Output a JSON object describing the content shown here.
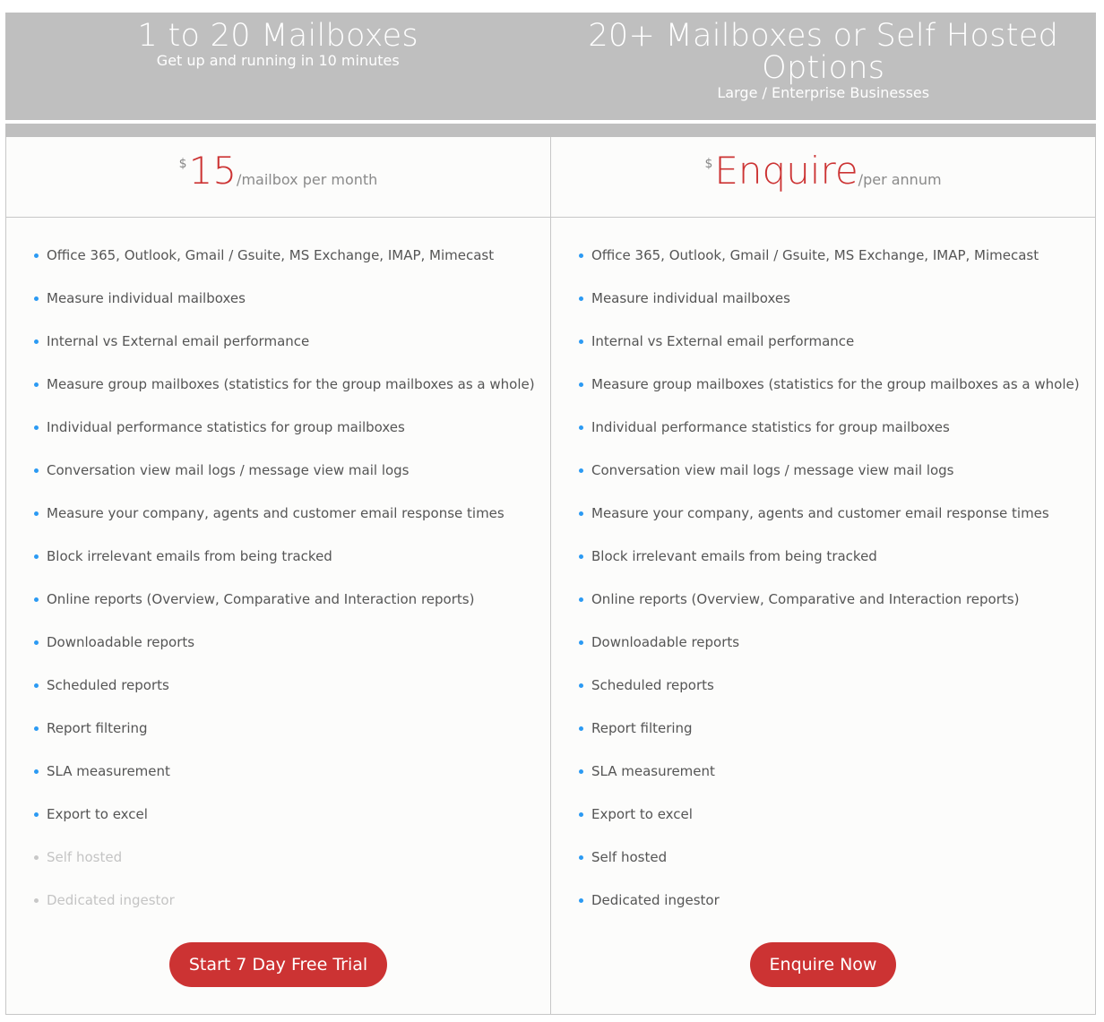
{
  "plans": [
    {
      "title": "1 to 20 Mailboxes",
      "subtitle": "Get up and running in 10 minutes",
      "currency": "$",
      "amount": "15",
      "period": "/mailbox per month",
      "cta": "Start 7 Day Free Trial",
      "features": [
        {
          "label": "Office 365, Outlook, Gmail / Gsuite, MS Exchange, IMAP, Mimecast",
          "included": true
        },
        {
          "label": "Measure individual mailboxes",
          "included": true
        },
        {
          "label": "Internal vs External email performance",
          "included": true
        },
        {
          "label": "Measure group mailboxes (statistics for the group mailboxes as a whole)",
          "included": true
        },
        {
          "label": "Individual performance statistics for group mailboxes",
          "included": true
        },
        {
          "label": "Conversation view mail logs / message view mail logs",
          "included": true
        },
        {
          "label": "Measure your company, agents and customer email response times",
          "included": true
        },
        {
          "label": "Block irrelevant emails from being tracked",
          "included": true
        },
        {
          "label": "Online reports (Overview, Comparative and Interaction reports)",
          "included": true
        },
        {
          "label": "Downloadable reports",
          "included": true
        },
        {
          "label": "Scheduled reports",
          "included": true
        },
        {
          "label": "Report filtering",
          "included": true
        },
        {
          "label": "SLA measurement",
          "included": true
        },
        {
          "label": "Export to excel",
          "included": true
        },
        {
          "label": "Self hosted",
          "included": false
        },
        {
          "label": "Dedicated ingestor",
          "included": false
        }
      ]
    },
    {
      "title": "20+ Mailboxes or Self Hosted Options",
      "subtitle": "Large / Enterprise Businesses",
      "currency": "$",
      "amount": "Enquire",
      "period": "/per annum",
      "cta": "Enquire Now",
      "features": [
        {
          "label": "Office 365, Outlook, Gmail / Gsuite, MS Exchange, IMAP, Mimecast",
          "included": true
        },
        {
          "label": "Measure individual mailboxes",
          "included": true
        },
        {
          "label": "Internal vs External email performance",
          "included": true
        },
        {
          "label": "Measure group mailboxes (statistics for the group mailboxes as a whole)",
          "included": true
        },
        {
          "label": "Individual performance statistics for group mailboxes",
          "included": true
        },
        {
          "label": "Conversation view mail logs / message view mail logs",
          "included": true
        },
        {
          "label": "Measure your company, agents and customer email response times",
          "included": true
        },
        {
          "label": "Block irrelevant emails from being tracked",
          "included": true
        },
        {
          "label": "Online reports (Overview, Comparative and Interaction reports)",
          "included": true
        },
        {
          "label": "Downloadable reports",
          "included": true
        },
        {
          "label": "Scheduled reports",
          "included": true
        },
        {
          "label": "Report filtering",
          "included": true
        },
        {
          "label": "SLA measurement",
          "included": true
        },
        {
          "label": "Export to excel",
          "included": true
        },
        {
          "label": "Self hosted",
          "included": true
        },
        {
          "label": "Dedicated ingestor",
          "included": true
        }
      ]
    }
  ],
  "colors": {
    "header_bg": "#bfbfbf",
    "price": "#cc3333",
    "bullet": "#2b9af3",
    "cta_bg": "#cc3333"
  }
}
